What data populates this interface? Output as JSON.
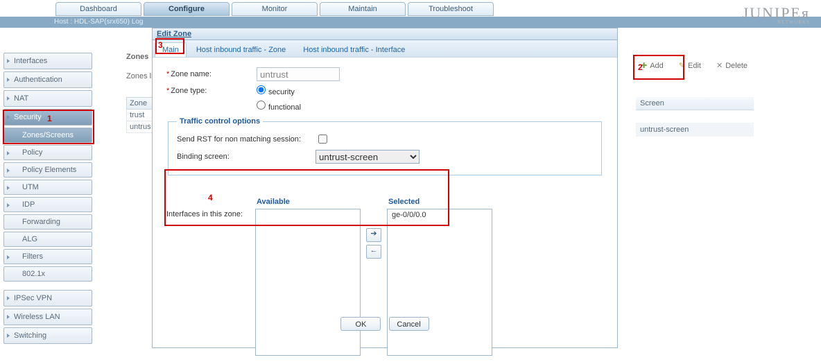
{
  "brand": {
    "name": "JUNIPEᴙ",
    "sub": "NETWORKS"
  },
  "hostline": "Host : HDL-SAP(srx650)     Log",
  "top_tabs": {
    "dashboard": "Dashboard",
    "configure": "Configure",
    "monitor": "Monitor",
    "maintain": "Maintain",
    "troubleshoot": "Troubleshoot"
  },
  "sidebar": {
    "interfaces": "Interfaces",
    "authentication": "Authentication",
    "nat": "NAT",
    "security": "Security",
    "zones_screens": "Zones/Screens",
    "policy": "Policy",
    "policy_elements": "Policy Elements",
    "utm": "UTM",
    "idp": "IDP",
    "forwarding": "Forwarding",
    "alg": "ALG",
    "filters": "Filters",
    "dot1x": "802.1x",
    "ipsecvpn": "IPSec VPN",
    "wlan": "Wireless LAN",
    "switching": "Switching"
  },
  "zones_header": "Zones",
  "zones_list_label": "Zones li",
  "zone_col_hdr": "Zone",
  "zone_rows": [
    "trust",
    "untrus"
  ],
  "actions": {
    "add": "Add",
    "edit": "Edit",
    "delete": "Delete"
  },
  "screen": {
    "hdr": "Screen",
    "val": "untrust-screen"
  },
  "dlg": {
    "title": "Edit Zone",
    "tabs": {
      "main": "Main",
      "zone": "Host inbound traffic - Zone",
      "iface": "Host inbound traffic - Interface"
    },
    "fields": {
      "zone_name_lbl": "Zone name:",
      "zone_name_val": "untrust",
      "zone_type_lbl": "Zone type:",
      "zt_security": "security",
      "zt_functional": "functional",
      "tco_legend": "Traffic control options",
      "rst_lbl": "Send RST for non matching session:",
      "bind_lbl": "Binding screen:",
      "bind_val": "untrust-screen",
      "iz_lbl": "Interfaces in this zone:",
      "avail_hdr": "Available",
      "sel_hdr": "Selected",
      "sel_item": "ge-0/0/0.0"
    },
    "btn_ok": "OK",
    "btn_cancel": "Cancel"
  },
  "anno": {
    "n1": "1",
    "n2": "2",
    "n3": "3",
    "n4": "4"
  }
}
